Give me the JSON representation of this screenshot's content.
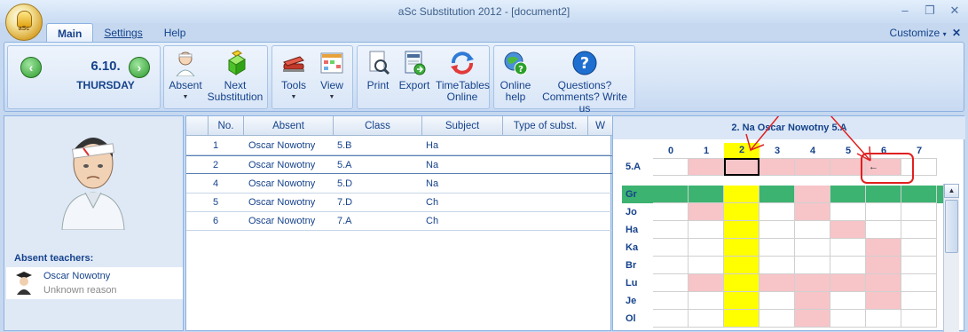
{
  "window": {
    "title": "aSc Substitution 2012  - [document2]",
    "orb_text": "aSc",
    "controls": {
      "minimize": "–",
      "restore": "❐",
      "close": "✕"
    }
  },
  "ribbon": {
    "tabs": [
      {
        "label": "Main",
        "active": true
      },
      {
        "label": "Settings",
        "active": false
      },
      {
        "label": "Help",
        "active": false
      }
    ],
    "customize": "Customize",
    "date": {
      "value": "6.10.",
      "day": "THURSDAY"
    },
    "buttons": {
      "absent": "Absent",
      "next_substitution": "Next Substitution",
      "tools": "Tools",
      "view": "View",
      "print": "Print",
      "export": "Export",
      "timetables_online": "TimeTables Online",
      "online_help": "Online help",
      "questions": "Questions? Comments? Write us"
    }
  },
  "left_panel": {
    "absent_teachers_label": "Absent teachers:",
    "teachers": [
      {
        "name": "Oscar Nowotny",
        "reason": "Unknown reason"
      }
    ]
  },
  "table": {
    "columns": [
      "",
      "No.",
      "Absent",
      "Class",
      "Subject",
      "Type of subst.",
      "W"
    ],
    "rows": [
      {
        "no": "1",
        "absent": "Oscar Nowotny",
        "class": "5.B",
        "subject": "Ha",
        "selected": false
      },
      {
        "no": "2",
        "absent": "Oscar Nowotny",
        "class": "5.A",
        "subject": "Na",
        "selected": true
      },
      {
        "no": "4",
        "absent": "Oscar Nowotny",
        "class": "5.D",
        "subject": "Na",
        "selected": false
      },
      {
        "no": "5",
        "absent": "Oscar Nowotny",
        "class": "7.D",
        "subject": "Ch",
        "selected": false
      },
      {
        "no": "6",
        "absent": "Oscar Nowotny",
        "class": "7.A",
        "subject": "Ch",
        "selected": false
      }
    ]
  },
  "timetable": {
    "title": "2. Na Oscar Nowotny 5.A",
    "periods": [
      "0",
      "1",
      "2",
      "3",
      "4",
      "5",
      "6",
      "7"
    ],
    "highlight_period": "2",
    "class_row": {
      "label": "5.A",
      "pink": [
        1,
        2,
        3,
        4,
        5,
        6
      ],
      "selected": 2,
      "arrow_cell": 6,
      "arrow": "←"
    },
    "teachers": [
      {
        "label": "Gr",
        "green": true,
        "pink": [
          4
        ]
      },
      {
        "label": "Jo",
        "pink": [
          1,
          4
        ]
      },
      {
        "label": "Ha",
        "pink": [
          5
        ]
      },
      {
        "label": "Ka",
        "pink": [
          6
        ]
      },
      {
        "label": "Br",
        "pink": [
          6
        ]
      },
      {
        "label": "Lu",
        "pink": [
          1,
          3,
          4,
          5,
          6
        ]
      },
      {
        "label": "Je",
        "pink": [
          4,
          6
        ]
      },
      {
        "label": "Ol",
        "pink": [
          4
        ]
      }
    ],
    "colors": {
      "pink": "#f7c4c8",
      "yellow": "#ffff00",
      "green": "#3cb371",
      "annotation": "#e02020"
    }
  }
}
